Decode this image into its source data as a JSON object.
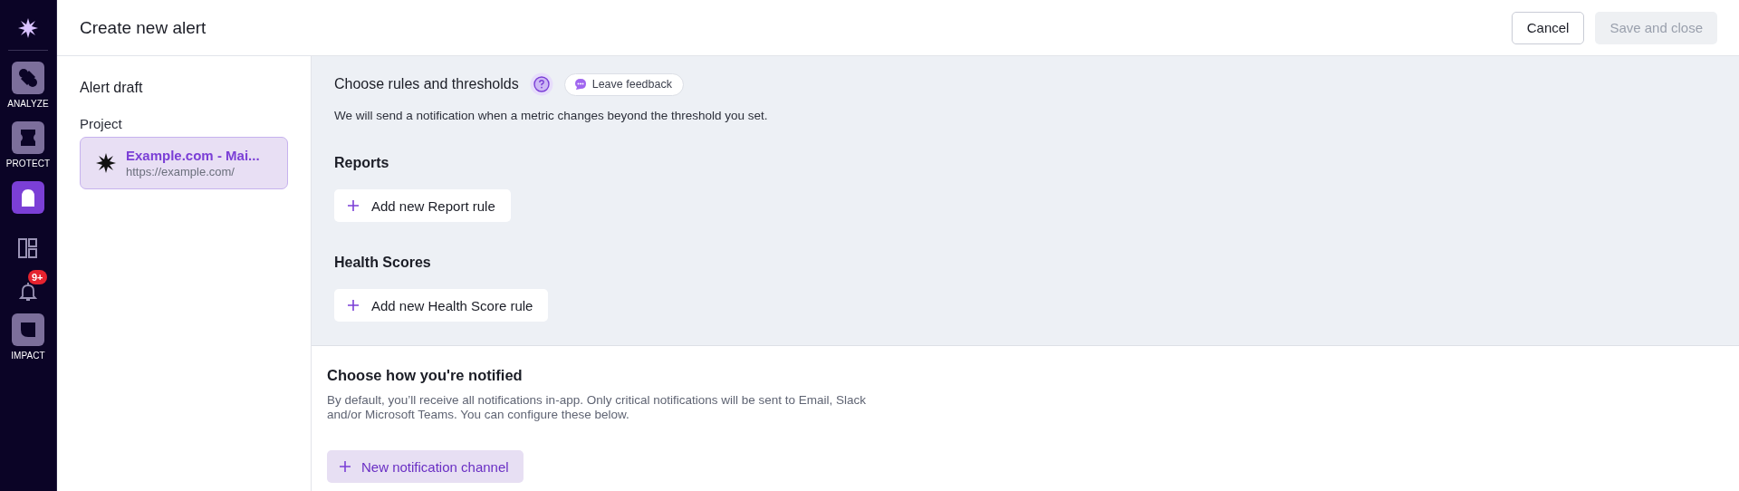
{
  "sidebar": {
    "items": [
      {
        "kind": "app",
        "label": "ANALYZE",
        "selected": false
      },
      {
        "kind": "app",
        "label": "PROTECT",
        "selected": false
      },
      {
        "kind": "app",
        "selected": true
      },
      {
        "kind": "icon",
        "selected": false
      },
      {
        "kind": "icon",
        "selected": false,
        "badge": "9+"
      },
      {
        "kind": "app",
        "label": "IMPACT",
        "selected": false
      }
    ]
  },
  "header": {
    "title": "Create new alert",
    "buttons": [
      {
        "label": "Cancel",
        "disabled": false
      },
      {
        "label": "Save and close",
        "disabled": true
      }
    ]
  },
  "draft": {
    "heading": "Alert draft",
    "project_label": "Project",
    "project": {
      "name": "Example.com - Mai...",
      "url": "https://example.com/",
      "selected": true
    }
  },
  "rules": {
    "title": "Choose rules and thresholds",
    "feedback": "Leave feedback",
    "description": "We will send a notification when a metric changes beyond the threshold you set.",
    "groups": [
      {
        "title": "Reports",
        "button": "Add new Report rule"
      },
      {
        "title": "Health Scores",
        "button": "Add new Health Score rule"
      }
    ]
  },
  "notify": {
    "title": "Choose how you're notified",
    "description": "By default, you’ll receive all notifications in-app. Only critical notifications will be sent to Email, Slack and/or Microsoft Teams. You can configure these below.",
    "button": "New notification channel"
  }
}
